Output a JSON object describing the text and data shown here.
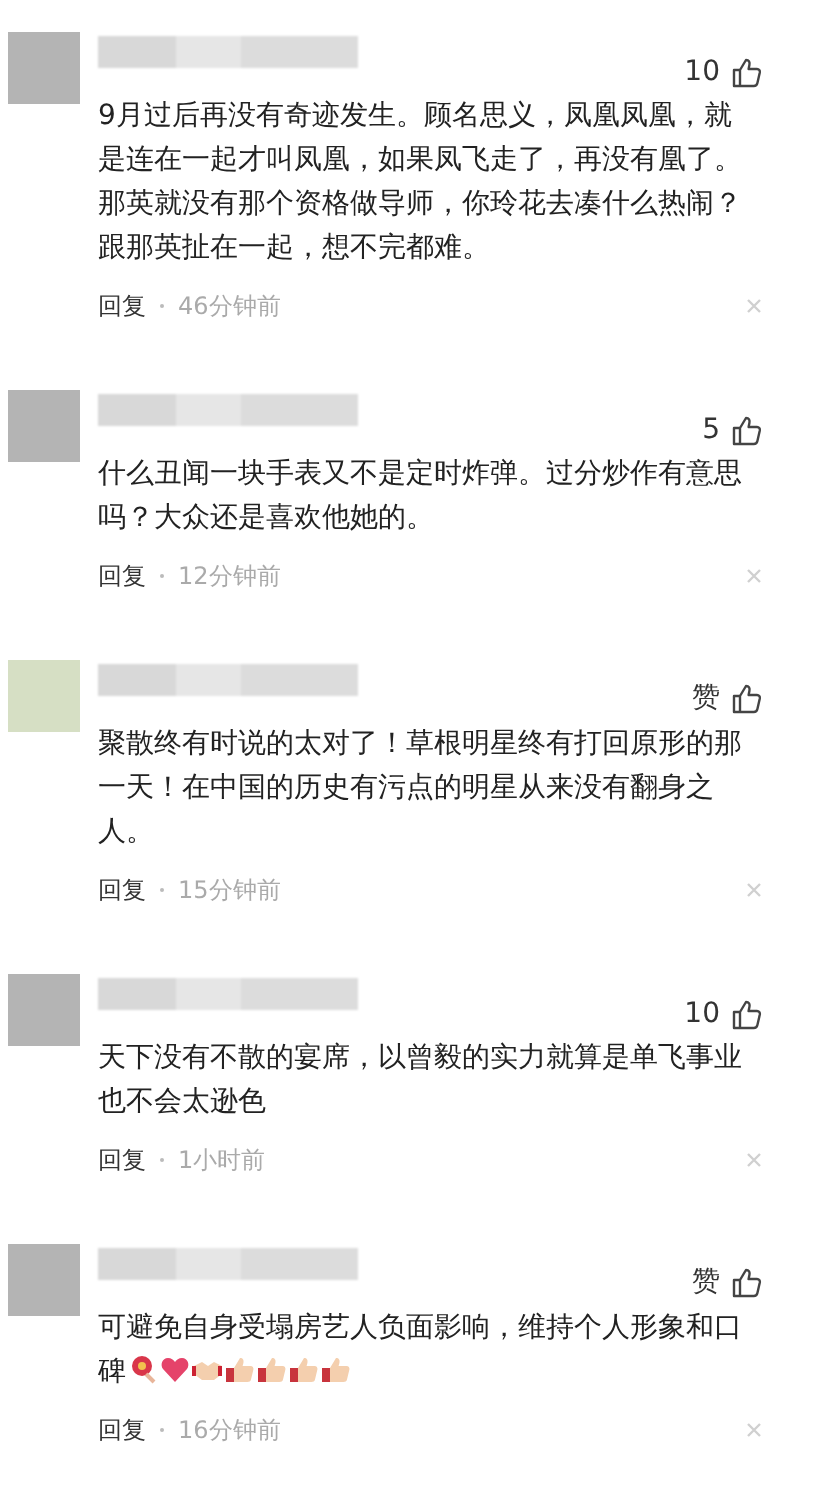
{
  "comments": [
    {
      "avatar": {
        "color": "#b4b4b4"
      },
      "likes": "10",
      "text": "9月过后再没有奇迹发生。顾名思义，凤凰凤凰，就是连在一起才叫凤凰，如果凤飞走了，再没有凰了。那英就没有那个资格做导师，你玲花去凑什么热闹？跟那英扯在一起，想不完都难。",
      "reply": "回复",
      "time": "46分钟前"
    },
    {
      "avatar": {
        "color": "#b4b4b4"
      },
      "likes": "5",
      "text": "什么丑闻一块手表又不是定时炸弹。过分炒作有意思吗？大众还是喜欢他她的。",
      "reply": "回复",
      "time": "12分钟前"
    },
    {
      "avatar": {
        "color": "#d6dfc4"
      },
      "likes": "赞",
      "text": "聚散终有时说的太对了！草根明星终有打回原形的那一天！在中国的历史有污点的明星从来没有翻身之人。",
      "reply": "回复",
      "time": "15分钟前"
    },
    {
      "avatar": {
        "color": "#b4b4b4"
      },
      "likes": "10",
      "text": "天下没有不散的宴席，以曾毅的实力就算是单飞事业也不会太逊色",
      "reply": "回复",
      "time": "1小时前"
    },
    {
      "avatar": {
        "color": "#b4b4b4"
      },
      "likes": "赞",
      "text": "可避免自身受塌房艺人负面影响，维持个人形象和口碑",
      "icons": [
        {
          "kind": "flower"
        },
        {
          "kind": "heart"
        },
        {
          "kind": "handshake"
        },
        {
          "kind": "thumb"
        },
        {
          "kind": "thumb"
        },
        {
          "kind": "thumb"
        },
        {
          "kind": "thumb"
        }
      ],
      "reply": "回复",
      "time": "16分钟前"
    }
  ]
}
